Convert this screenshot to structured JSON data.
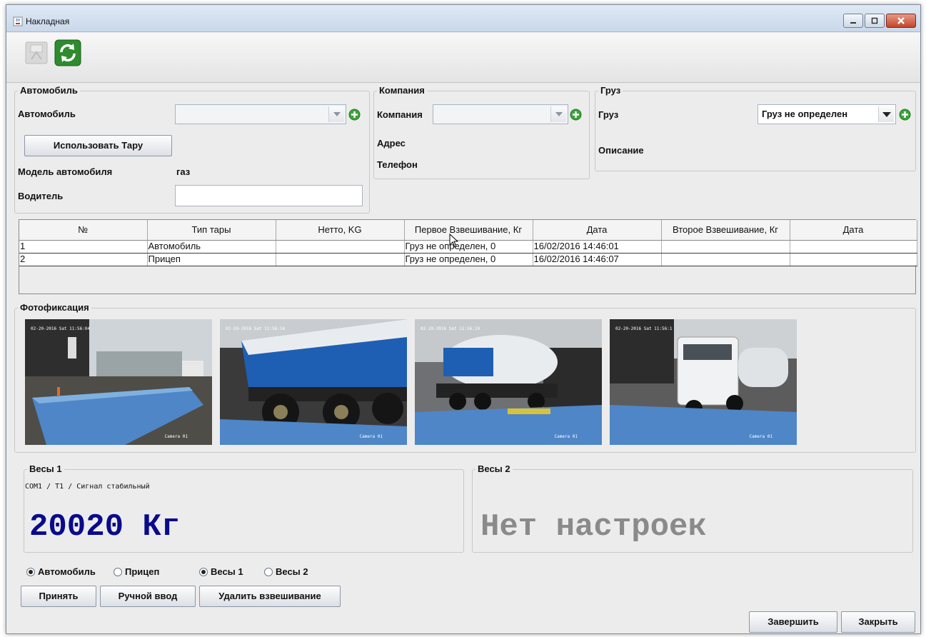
{
  "window": {
    "title": "Накладная",
    "icon": "java-cup-icon"
  },
  "toolbar": {
    "buttons": [
      {
        "icon": "printer-disabled-icon"
      },
      {
        "icon": "refresh-icon"
      }
    ]
  },
  "vehicle": {
    "group_title": "Автомобиль",
    "vehicle_label": "Автомобиль",
    "vehicle_value": "",
    "use_tare_button": "Использовать Тару",
    "model_label": "Модель автомобиля",
    "model_value": "газ",
    "driver_label": "Водитель",
    "driver_value": ""
  },
  "company": {
    "group_title": "Компания",
    "company_label": "Компания",
    "company_value": "",
    "address_label": "Адрес",
    "phone_label": "Телефон"
  },
  "cargo": {
    "group_title": "Груз",
    "cargo_label": "Груз",
    "cargo_value": "Груз не определен",
    "description_label": "Описание"
  },
  "table": {
    "headers": [
      "№",
      "Тип тары",
      "Нетто, KG",
      "Первое Взвешивание, Кг",
      "Дата",
      "Второе Взвешивание, Кг",
      "Дата"
    ],
    "rows": [
      [
        "1",
        "Автомобиль",
        "",
        "Груз не определен, 0",
        "16/02/2016 14:46:01",
        "",
        ""
      ],
      [
        "2",
        "Прицеп",
        "",
        "Груз не определен, 0",
        "16/02/2016 14:46:07",
        "",
        ""
      ]
    ]
  },
  "photos": {
    "group_title": "Фотофиксация",
    "items": [
      {
        "timestamp": "02-20-2016 Sat 11:56:04",
        "camera": "Camera 01"
      },
      {
        "timestamp": "02-20-2016 Sat 11:56:14",
        "camera": "Camera 01"
      },
      {
        "timestamp": "02-20-2016 Sat 11:56:19",
        "camera": "Camera 01"
      },
      {
        "timestamp": "02-20-2016 Sat 11:56:1",
        "camera": "Camera 01"
      }
    ]
  },
  "scale1": {
    "group_title": "Весы 1",
    "status": "COM1 / T1 / Сигнал стабильный",
    "reading": "20020 Кг",
    "reading_color": "#0a0a8c"
  },
  "scale2": {
    "group_title": "Весы 2",
    "reading": "Нет настроек",
    "reading_color": "#8a8a8a"
  },
  "options": {
    "vehicle_radio": "Автомобиль",
    "trailer_radio": "Прицеп",
    "scale1_radio": "Весы 1",
    "scale2_radio": "Весы 2",
    "selected_type": "Автомобиль",
    "selected_scale": "Весы 1"
  },
  "actions": {
    "accept": "Принять",
    "manual_input": "Ручной ввод",
    "delete_weighing": "Удалить взвешивание",
    "finish": "Завершить",
    "close": "Закрыть"
  }
}
